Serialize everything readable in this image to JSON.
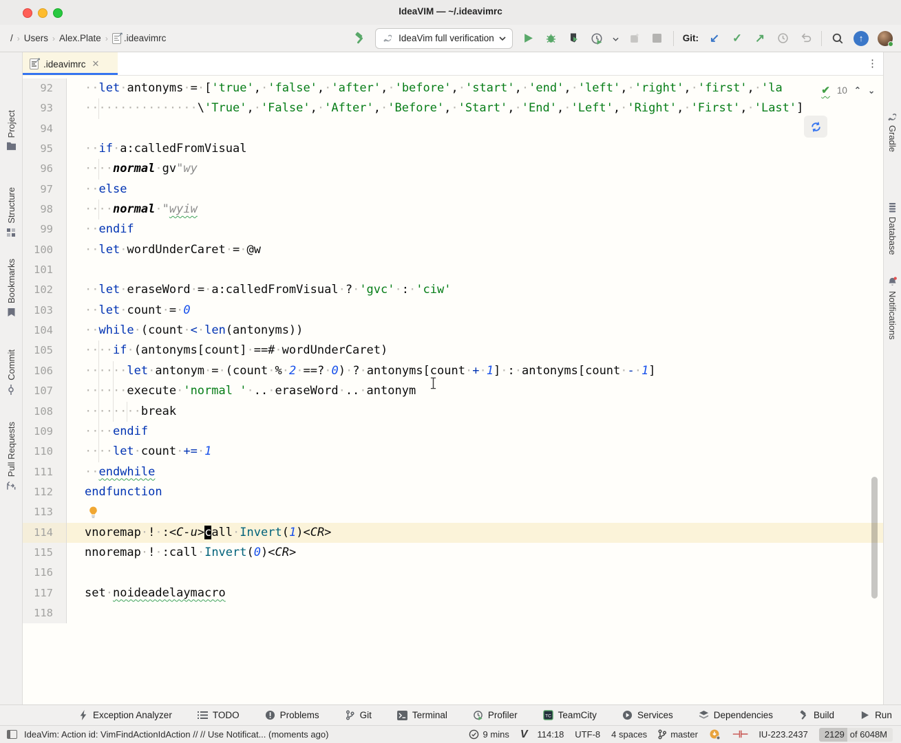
{
  "window": {
    "title": "IdeaVIM — ~/.ideavimrc"
  },
  "breadcrumbs": {
    "items": [
      "/",
      "Users",
      "Alex.Plate",
      ".ideavimrc"
    ]
  },
  "run": {
    "config": "IdeaVim full verification",
    "git_label": "Git:"
  },
  "tab": {
    "label": ".ideavimrc"
  },
  "left_stripe": [
    "Project",
    "Structure",
    "Bookmarks",
    "Commit",
    "Pull Requests"
  ],
  "right_stripe": [
    "Gradle",
    "Database",
    "Notifications"
  ],
  "inspections": {
    "count": "10"
  },
  "editor": {
    "lines": [
      {
        "n": "92",
        "seg": [
          [
            "ws",
            "··"
          ],
          [
            "kw",
            "let"
          ],
          [
            "ws",
            "·"
          ],
          [
            "pl",
            "antonyms"
          ],
          [
            "ws",
            "·"
          ],
          [
            "pl",
            "="
          ],
          [
            "ws",
            "·"
          ],
          [
            "pl",
            "["
          ],
          [
            "str",
            "'true'"
          ],
          [
            "pl",
            ","
          ],
          [
            "ws",
            "·"
          ],
          [
            "str",
            "'false'"
          ],
          [
            "pl",
            ","
          ],
          [
            "ws",
            "·"
          ],
          [
            "str",
            "'after'"
          ],
          [
            "pl",
            ","
          ],
          [
            "ws",
            "·"
          ],
          [
            "str",
            "'before'"
          ],
          [
            "pl",
            ","
          ],
          [
            "ws",
            "·"
          ],
          [
            "str",
            "'start'"
          ],
          [
            "pl",
            ","
          ],
          [
            "ws",
            "·"
          ],
          [
            "str",
            "'end'"
          ],
          [
            "pl",
            ","
          ],
          [
            "ws",
            "·"
          ],
          [
            "str",
            "'left'"
          ],
          [
            "pl",
            ","
          ],
          [
            "ws",
            "·"
          ],
          [
            "str",
            "'right'"
          ],
          [
            "pl",
            ","
          ],
          [
            "ws",
            "·"
          ],
          [
            "str",
            "'first'"
          ],
          [
            "pl",
            ","
          ],
          [
            "ws",
            "·"
          ],
          [
            "str",
            "'la"
          ]
        ]
      },
      {
        "n": "93",
        "g": [
          2
        ],
        "seg": [
          [
            "ws",
            "················"
          ],
          [
            "pl",
            "\\"
          ],
          [
            "str",
            "'True'"
          ],
          [
            "pl",
            ","
          ],
          [
            "ws",
            "·"
          ],
          [
            "str",
            "'False'"
          ],
          [
            "pl",
            ","
          ],
          [
            "ws",
            "·"
          ],
          [
            "str",
            "'After'"
          ],
          [
            "pl",
            ","
          ],
          [
            "ws",
            "·"
          ],
          [
            "str",
            "'Before'"
          ],
          [
            "pl",
            ","
          ],
          [
            "ws",
            "·"
          ],
          [
            "str",
            "'Start'"
          ],
          [
            "pl",
            ","
          ],
          [
            "ws",
            "·"
          ],
          [
            "str",
            "'End'"
          ],
          [
            "pl",
            ","
          ],
          [
            "ws",
            "·"
          ],
          [
            "str",
            "'Left'"
          ],
          [
            "pl",
            ","
          ],
          [
            "ws",
            "·"
          ],
          [
            "str",
            "'Right'"
          ],
          [
            "pl",
            ","
          ],
          [
            "ws",
            "·"
          ],
          [
            "str",
            "'First'"
          ],
          [
            "pl",
            ","
          ],
          [
            "ws",
            "·"
          ],
          [
            "str",
            "'Last'"
          ],
          [
            "pl",
            "]"
          ]
        ]
      },
      {
        "n": "94",
        "seg": []
      },
      {
        "n": "95",
        "seg": [
          [
            "ws",
            "··"
          ],
          [
            "kw",
            "if"
          ],
          [
            "ws",
            "·"
          ],
          [
            "pl",
            "a:calledFromVisual"
          ]
        ]
      },
      {
        "n": "96",
        "g": [
          2
        ],
        "seg": [
          [
            "ws",
            "····"
          ],
          [
            "cmd",
            "normal"
          ],
          [
            "ws",
            "·"
          ],
          [
            "pl",
            "gv"
          ],
          [
            "cmt",
            "\"wy"
          ]
        ]
      },
      {
        "n": "97",
        "seg": [
          [
            "ws",
            "··"
          ],
          [
            "kw",
            "else"
          ]
        ]
      },
      {
        "n": "98",
        "g": [
          2
        ],
        "seg": [
          [
            "ws",
            "····"
          ],
          [
            "cmd",
            "normal"
          ],
          [
            "ws",
            "·"
          ],
          [
            "cmt",
            "\""
          ],
          [
            "cmt sq",
            "wyiw"
          ]
        ]
      },
      {
        "n": "99",
        "seg": [
          [
            "ws",
            "··"
          ],
          [
            "kw",
            "endif"
          ]
        ]
      },
      {
        "n": "100",
        "seg": [
          [
            "ws",
            "··"
          ],
          [
            "kw",
            "let"
          ],
          [
            "ws",
            "·"
          ],
          [
            "pl",
            "wordUnderCaret"
          ],
          [
            "ws",
            "·"
          ],
          [
            "pl",
            "="
          ],
          [
            "ws",
            "·"
          ],
          [
            "pl",
            "@w"
          ]
        ]
      },
      {
        "n": "101",
        "seg": []
      },
      {
        "n": "102",
        "seg": [
          [
            "ws",
            "··"
          ],
          [
            "kw",
            "let"
          ],
          [
            "ws",
            "·"
          ],
          [
            "pl",
            "eraseWord"
          ],
          [
            "ws",
            "·"
          ],
          [
            "pl",
            "="
          ],
          [
            "ws",
            "·"
          ],
          [
            "pl",
            "a:calledFromVisual"
          ],
          [
            "ws",
            "·"
          ],
          [
            "pl",
            "?"
          ],
          [
            "ws",
            "·"
          ],
          [
            "str",
            "'gvc'"
          ],
          [
            "ws",
            "·"
          ],
          [
            "pl",
            ":"
          ],
          [
            "ws",
            "·"
          ],
          [
            "str",
            "'ciw'"
          ]
        ]
      },
      {
        "n": "103",
        "seg": [
          [
            "ws",
            "··"
          ],
          [
            "kw",
            "let"
          ],
          [
            "ws",
            "·"
          ],
          [
            "pl",
            "count"
          ],
          [
            "ws",
            "·"
          ],
          [
            "pl",
            "="
          ],
          [
            "ws",
            "·"
          ],
          [
            "num",
            "0"
          ]
        ]
      },
      {
        "n": "104",
        "seg": [
          [
            "ws",
            "··"
          ],
          [
            "kw",
            "while"
          ],
          [
            "ws",
            "·"
          ],
          [
            "pl",
            "(count"
          ],
          [
            "ws",
            "·"
          ],
          [
            "op",
            "<"
          ],
          [
            "ws",
            "·"
          ],
          [
            "kw",
            "len"
          ],
          [
            "pl",
            "(antonyms))"
          ]
        ]
      },
      {
        "n": "105",
        "g": [
          2
        ],
        "seg": [
          [
            "ws",
            "····"
          ],
          [
            "kw",
            "if"
          ],
          [
            "ws",
            "·"
          ],
          [
            "pl",
            "(antonyms[count]"
          ],
          [
            "ws",
            "·"
          ],
          [
            "pl",
            "==#"
          ],
          [
            "ws",
            "·"
          ],
          [
            "pl",
            "wordUnderCaret)"
          ]
        ]
      },
      {
        "n": "106",
        "g": [
          2,
          4
        ],
        "seg": [
          [
            "ws",
            "······"
          ],
          [
            "kw",
            "let"
          ],
          [
            "ws",
            "·"
          ],
          [
            "pl",
            "antonym"
          ],
          [
            "ws",
            "·"
          ],
          [
            "pl",
            "="
          ],
          [
            "ws",
            "·"
          ],
          [
            "pl",
            "(count"
          ],
          [
            "ws",
            "·"
          ],
          [
            "pl",
            "%"
          ],
          [
            "ws",
            "·"
          ],
          [
            "num",
            "2"
          ],
          [
            "ws",
            "·"
          ],
          [
            "pl",
            "==?"
          ],
          [
            "ws",
            "·"
          ],
          [
            "num",
            "0"
          ],
          [
            "pl",
            ")"
          ],
          [
            "ws",
            "·"
          ],
          [
            "pl",
            "?"
          ],
          [
            "ws",
            "·"
          ],
          [
            "pl",
            "antonyms[count"
          ],
          [
            "ws",
            "·"
          ],
          [
            "op",
            "+"
          ],
          [
            "ws",
            "·"
          ],
          [
            "num",
            "1"
          ],
          [
            "pl",
            "]"
          ],
          [
            "ws",
            "·"
          ],
          [
            "pl",
            ":"
          ],
          [
            "ws",
            "·"
          ],
          [
            "pl",
            "antonyms[count"
          ],
          [
            "ws",
            "·"
          ],
          [
            "op",
            "-"
          ],
          [
            "ws",
            "·"
          ],
          [
            "num",
            "1"
          ],
          [
            "pl",
            "]"
          ]
        ]
      },
      {
        "n": "107",
        "g": [
          2,
          4
        ],
        "seg": [
          [
            "ws",
            "······"
          ],
          [
            "pl",
            "execute"
          ],
          [
            "ws",
            "·"
          ],
          [
            "str",
            "'normal '"
          ],
          [
            "ws",
            "·"
          ],
          [
            "pl",
            ".."
          ],
          [
            "ws",
            "·"
          ],
          [
            "pl",
            "eraseWord"
          ],
          [
            "ws",
            "·"
          ],
          [
            "pl",
            ".."
          ],
          [
            "ws",
            "·"
          ],
          [
            "pl",
            "antonym"
          ]
        ]
      },
      {
        "n": "108",
        "g": [
          2,
          4,
          6
        ],
        "seg": [
          [
            "ws",
            "········"
          ],
          [
            "pl",
            "break"
          ]
        ]
      },
      {
        "n": "109",
        "g": [
          2
        ],
        "seg": [
          [
            "ws",
            "····"
          ],
          [
            "kw",
            "endif"
          ]
        ]
      },
      {
        "n": "110",
        "g": [
          2
        ],
        "seg": [
          [
            "ws",
            "····"
          ],
          [
            "kw",
            "let"
          ],
          [
            "ws",
            "·"
          ],
          [
            "pl",
            "count"
          ],
          [
            "ws",
            "·"
          ],
          [
            "op",
            "+="
          ],
          [
            "ws",
            "·"
          ],
          [
            "num",
            "1"
          ]
        ]
      },
      {
        "n": "111",
        "seg": [
          [
            "ws",
            "··"
          ],
          [
            "kw sq",
            "endwhile"
          ]
        ]
      },
      {
        "n": "112",
        "seg": [
          [
            "kw",
            "endfunction"
          ]
        ]
      },
      {
        "n": "113",
        "bulb": true,
        "seg": []
      },
      {
        "n": "114",
        "hl": true,
        "seg": [
          [
            "pl",
            "vnoremap"
          ],
          [
            "ws",
            "·"
          ],
          [
            "pl",
            "!"
          ],
          [
            "ws",
            "·"
          ],
          [
            "pl",
            ":"
          ],
          [
            "it",
            "<C-u>"
          ],
          [
            "cb",
            "c"
          ],
          [
            "pl",
            "all"
          ],
          [
            "ws",
            "·"
          ],
          [
            "fn",
            "Invert"
          ],
          [
            "pl",
            "("
          ],
          [
            "num",
            "1"
          ],
          [
            "pl",
            ")"
          ],
          [
            "it",
            "<CR>"
          ]
        ]
      },
      {
        "n": "115",
        "seg": [
          [
            "pl",
            "nnoremap"
          ],
          [
            "ws",
            "·"
          ],
          [
            "pl",
            "!"
          ],
          [
            "ws",
            "·"
          ],
          [
            "pl",
            ":call"
          ],
          [
            "ws",
            "·"
          ],
          [
            "fn",
            "Invert"
          ],
          [
            "pl",
            "("
          ],
          [
            "num",
            "0"
          ],
          [
            "pl",
            ")"
          ],
          [
            "it",
            "<CR>"
          ]
        ]
      },
      {
        "n": "116",
        "seg": []
      },
      {
        "n": "117",
        "seg": [
          [
            "pl",
            "set"
          ],
          [
            "ws",
            "·"
          ],
          [
            "pl sq",
            "noideadelaymacro"
          ]
        ]
      },
      {
        "n": "118",
        "seg": []
      }
    ]
  },
  "bottom_bar": {
    "items": [
      "Exception Analyzer",
      "TODO",
      "Problems",
      "Git",
      "Terminal",
      "Profiler",
      "TeamCity",
      "Services",
      "Dependencies",
      "Build",
      "Run"
    ]
  },
  "status_bar": {
    "message": "IdeaVim: Action id: VimFindActionIdAction // // Use Notificat... (moments ago)",
    "time": "9 mins",
    "position": "114:18",
    "encoding": "UTF-8",
    "indent": "4 spaces",
    "branch": "master",
    "build": "IU-223.2437",
    "memory_used": "2129",
    "memory_of": "of 6048M"
  }
}
